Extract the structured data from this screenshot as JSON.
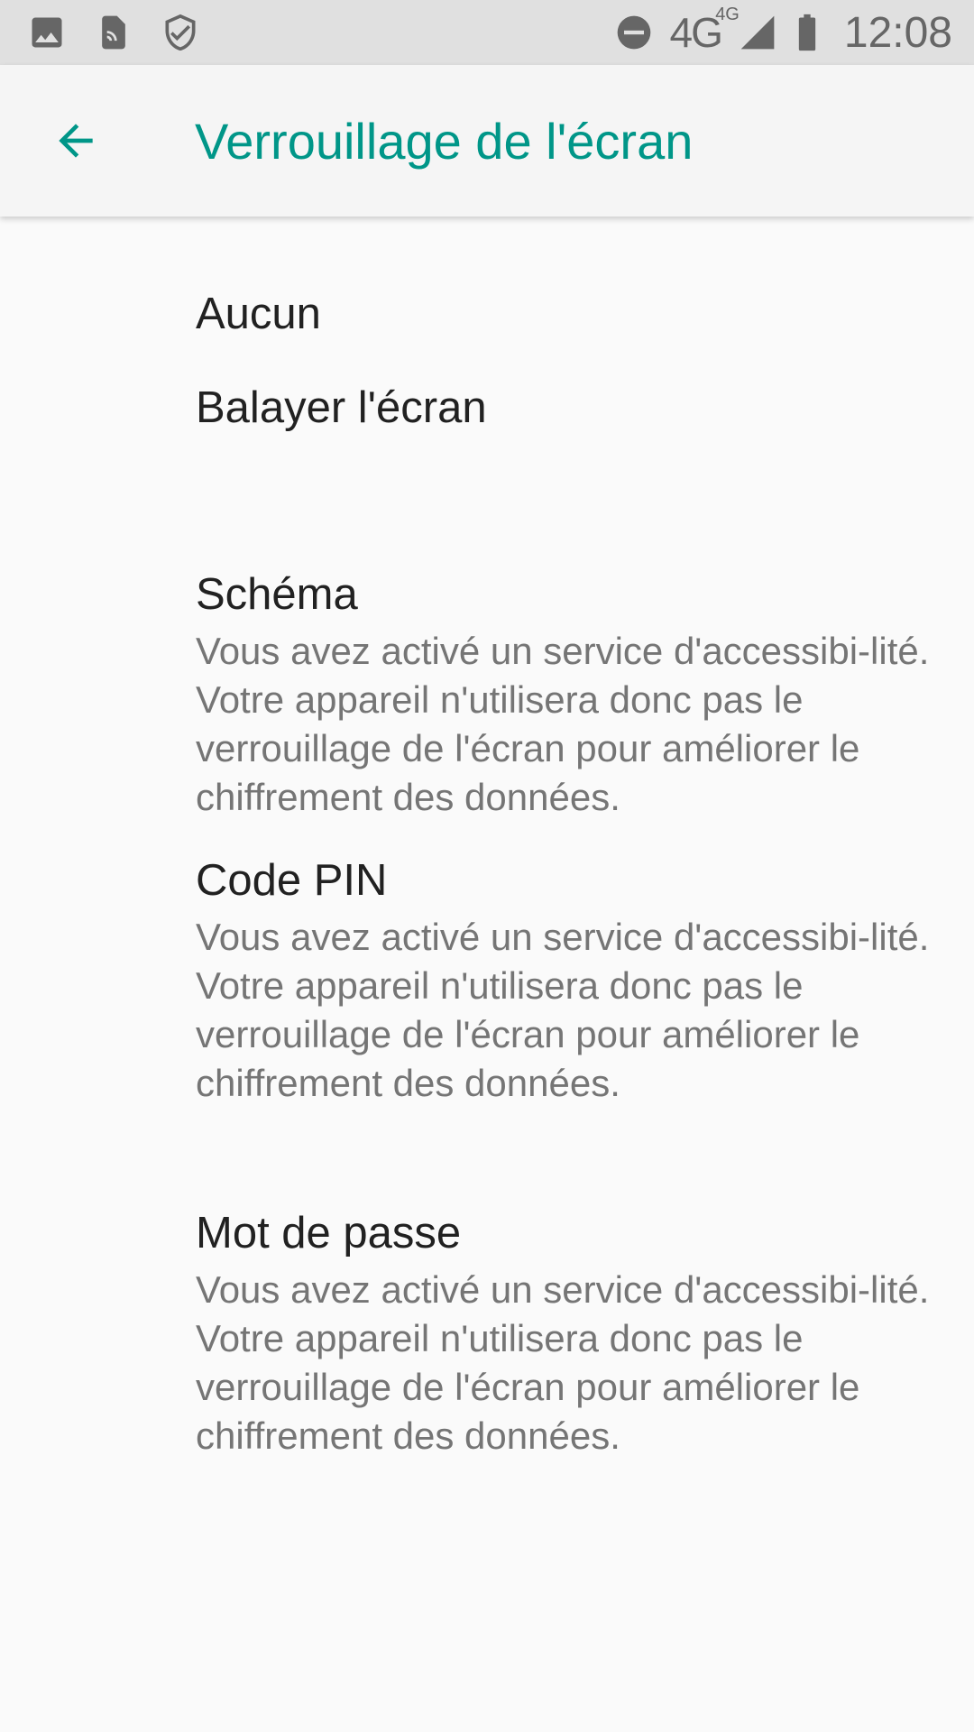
{
  "status_bar": {
    "time": "12:08",
    "network": "4G",
    "network_sup": "4G",
    "icons": [
      "image-icon",
      "nfc-tag-icon",
      "shield-check-icon",
      "do-not-disturb-icon",
      "signal-icon",
      "battery-icon"
    ]
  },
  "app_bar": {
    "title": "Verrouillage de l'écran",
    "back_icon": "arrow-back-icon",
    "accent": "#009688"
  },
  "options": [
    {
      "title": "Aucun"
    },
    {
      "title": "Balayer l'écran"
    },
    {
      "title": "Schéma",
      "summary": "Vous avez activé un service d'accessibi-lité. Votre appareil n'utilisera donc pas le verrouillage de l'écran pour améliorer le chiffrement des données."
    },
    {
      "title": "Code PIN",
      "summary": "Vous avez activé un service d'accessibi-lité. Votre appareil n'utilisera donc pas le verrouillage de l'écran pour améliorer le chiffrement des données."
    },
    {
      "title": "Mot de passe",
      "summary": "Vous avez activé un service d'accessibi-lité. Votre appareil n'utilisera donc pas le verrouillage de l'écran pour améliorer le chiffrement des données."
    }
  ]
}
